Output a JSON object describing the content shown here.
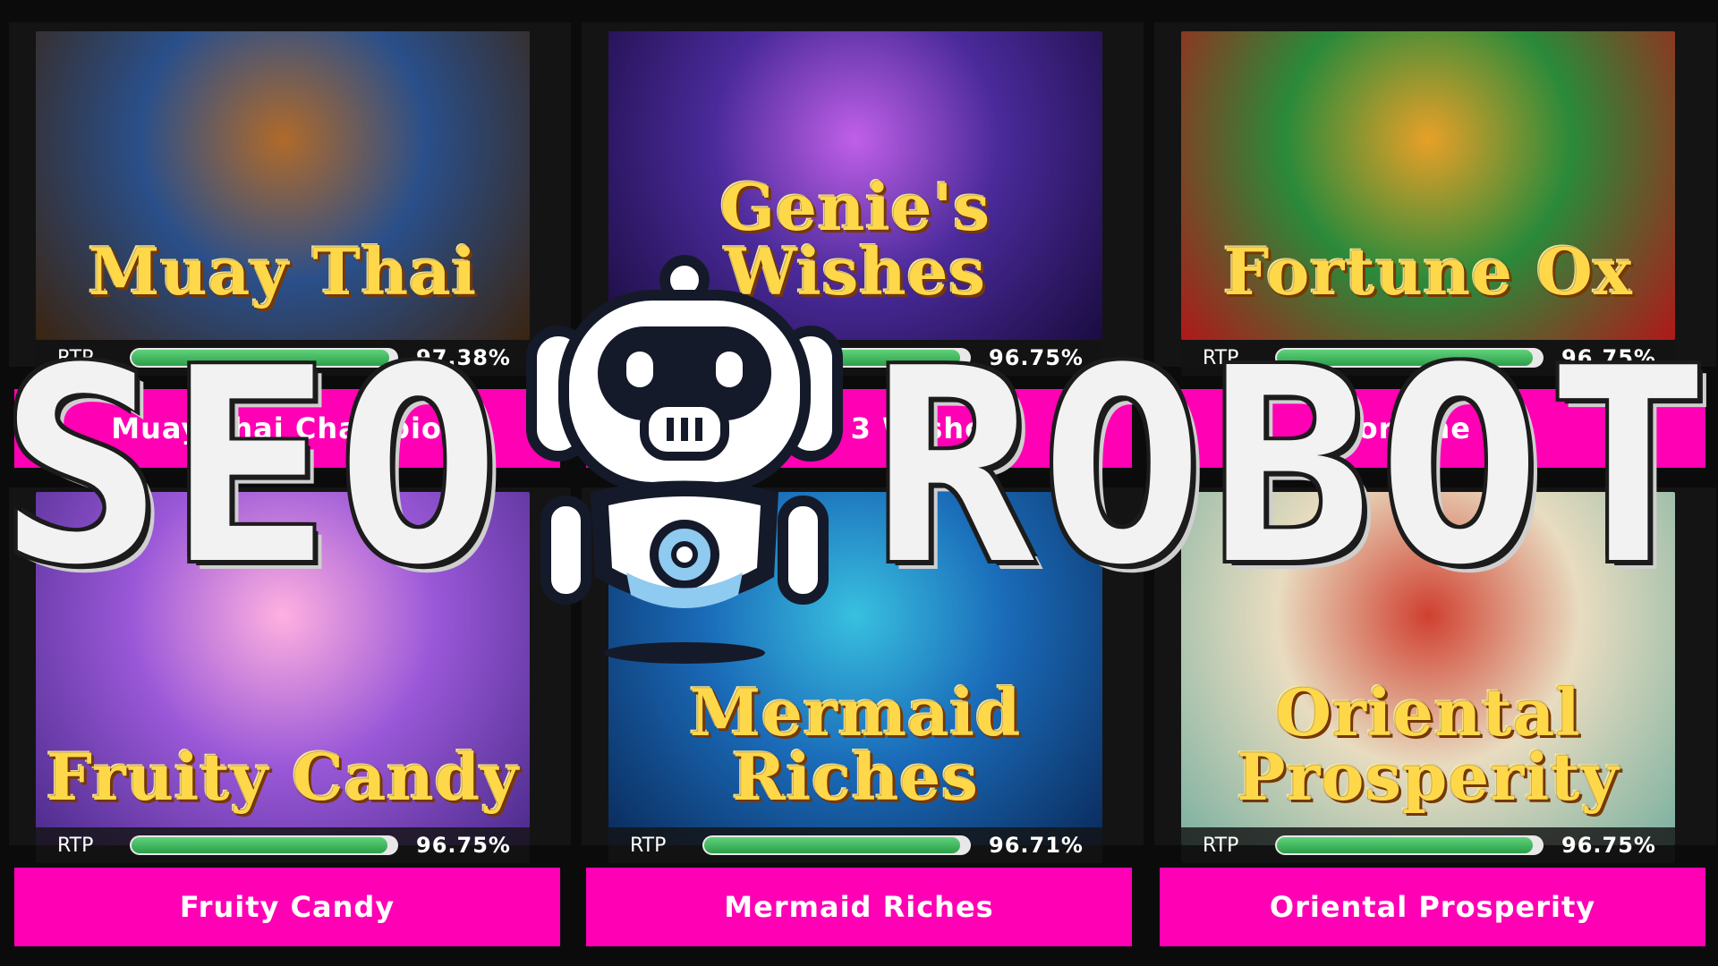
{
  "games": [
    {
      "name": "Muay Thai Champion",
      "art_title": "Muay Thai",
      "rtp_label": "RTP",
      "rtp_value": "97.38%",
      "rtp_fraction": 0.9738,
      "palette": [
        "#2a4f8a",
        "#b06a2a",
        "#3a2410"
      ]
    },
    {
      "name": "Genie's 3 Wishes",
      "art_title": "Genie's Wishes",
      "rtp_label": "RTP",
      "rtp_value": "96.75%",
      "rtp_fraction": 0.9675,
      "palette": [
        "#4a2a9a",
        "#c060e8",
        "#1a0c40"
      ]
    },
    {
      "name": "Fortune Ox",
      "art_title": "Fortune Ox",
      "rtp_label": "RTP",
      "rtp_value": "96.75%",
      "rtp_fraction": 0.9675,
      "palette": [
        "#2a8a3a",
        "#e8a028",
        "#b01818"
      ]
    },
    {
      "name": "Fruity Candy",
      "art_title": "Fruity Candy",
      "rtp_label": "RTP",
      "rtp_value": "96.75%",
      "rtp_fraction": 0.9675,
      "palette": [
        "#9a58d8",
        "#ffb0e0",
        "#4a2a8a"
      ]
    },
    {
      "name": "Mermaid Riches",
      "art_title": "Mermaid Riches",
      "rtp_label": "RTP",
      "rtp_value": "96.71%",
      "rtp_fraction": 0.9671,
      "palette": [
        "#1a6ab8",
        "#38c0e0",
        "#0a2a5a"
      ]
    },
    {
      "name": "Oriental Prosperity",
      "art_title": "Oriental Prosperity",
      "rtp_label": "RTP",
      "rtp_value": "96.75%",
      "rtp_fraction": 0.9675,
      "palette": [
        "#e8dcc0",
        "#d04030",
        "#7ab0a0"
      ]
    }
  ],
  "logo": {
    "left_word": "SEO",
    "right_word": "ROBOT",
    "icon": "robot-icon"
  },
  "colors": {
    "accent": "#ff00b4",
    "rtp_fill": "#2c9e4a",
    "background": "#0b0b0b"
  }
}
